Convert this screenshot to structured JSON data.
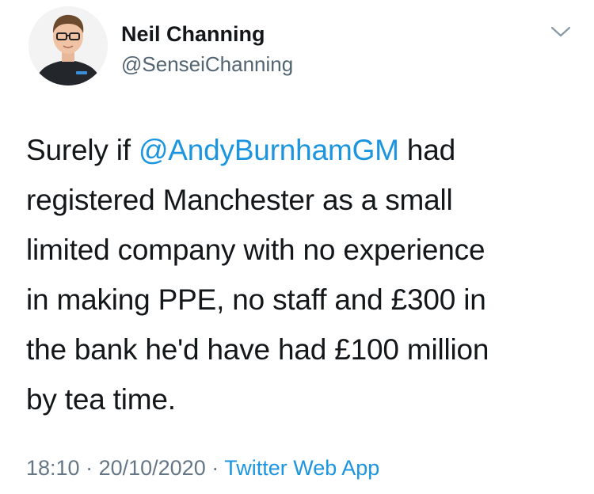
{
  "author": {
    "display_name": "Neil Channing",
    "handle": "@SenseiChanning"
  },
  "menu": {
    "icon": "chevron-down-icon"
  },
  "tweet": {
    "lines": [
      {
        "before": "Surely if ",
        "mention": "@AndyBurnhamGM",
        "after": " had"
      },
      {
        "text": "registered Manchester as a small"
      },
      {
        "text": "limited company with no experience"
      },
      {
        "text": "in making PPE, no staff and £300 in"
      },
      {
        "text": "the bank he'd have had £100 million"
      },
      {
        "text": "by tea time."
      }
    ]
  },
  "meta": {
    "time": "18:10",
    "sep1": " · ",
    "date": "20/10/2020",
    "sep2": " · ",
    "source": "Twitter Web App"
  },
  "colors": {
    "link": "#1b95e0",
    "text": "#14171a",
    "secondary": "#657786"
  }
}
